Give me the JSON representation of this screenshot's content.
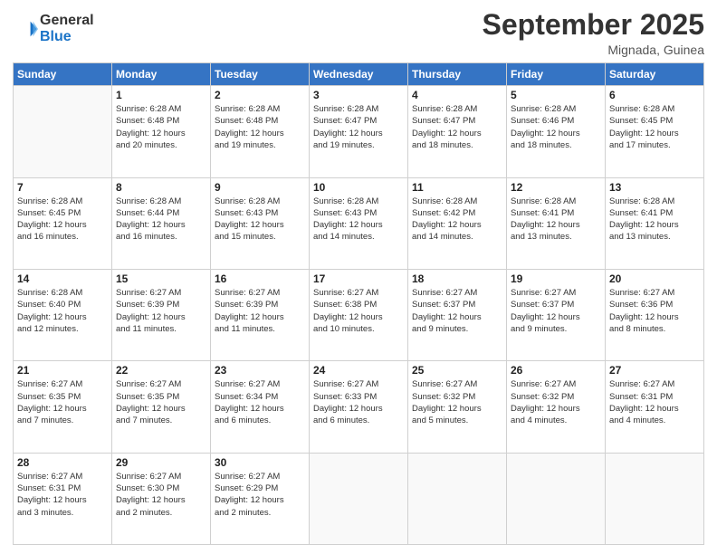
{
  "logo": {
    "general": "General",
    "blue": "Blue"
  },
  "header": {
    "month": "September 2025",
    "location": "Mignada, Guinea"
  },
  "days_of_week": [
    "Sunday",
    "Monday",
    "Tuesday",
    "Wednesday",
    "Thursday",
    "Friday",
    "Saturday"
  ],
  "weeks": [
    [
      {
        "day": "",
        "info": ""
      },
      {
        "day": "1",
        "info": "Sunrise: 6:28 AM\nSunset: 6:48 PM\nDaylight: 12 hours\nand 20 minutes."
      },
      {
        "day": "2",
        "info": "Sunrise: 6:28 AM\nSunset: 6:48 PM\nDaylight: 12 hours\nand 19 minutes."
      },
      {
        "day": "3",
        "info": "Sunrise: 6:28 AM\nSunset: 6:47 PM\nDaylight: 12 hours\nand 19 minutes."
      },
      {
        "day": "4",
        "info": "Sunrise: 6:28 AM\nSunset: 6:47 PM\nDaylight: 12 hours\nand 18 minutes."
      },
      {
        "day": "5",
        "info": "Sunrise: 6:28 AM\nSunset: 6:46 PM\nDaylight: 12 hours\nand 18 minutes."
      },
      {
        "day": "6",
        "info": "Sunrise: 6:28 AM\nSunset: 6:45 PM\nDaylight: 12 hours\nand 17 minutes."
      }
    ],
    [
      {
        "day": "7",
        "info": "Sunrise: 6:28 AM\nSunset: 6:45 PM\nDaylight: 12 hours\nand 16 minutes."
      },
      {
        "day": "8",
        "info": "Sunrise: 6:28 AM\nSunset: 6:44 PM\nDaylight: 12 hours\nand 16 minutes."
      },
      {
        "day": "9",
        "info": "Sunrise: 6:28 AM\nSunset: 6:43 PM\nDaylight: 12 hours\nand 15 minutes."
      },
      {
        "day": "10",
        "info": "Sunrise: 6:28 AM\nSunset: 6:43 PM\nDaylight: 12 hours\nand 14 minutes."
      },
      {
        "day": "11",
        "info": "Sunrise: 6:28 AM\nSunset: 6:42 PM\nDaylight: 12 hours\nand 14 minutes."
      },
      {
        "day": "12",
        "info": "Sunrise: 6:28 AM\nSunset: 6:41 PM\nDaylight: 12 hours\nand 13 minutes."
      },
      {
        "day": "13",
        "info": "Sunrise: 6:28 AM\nSunset: 6:41 PM\nDaylight: 12 hours\nand 13 minutes."
      }
    ],
    [
      {
        "day": "14",
        "info": "Sunrise: 6:28 AM\nSunset: 6:40 PM\nDaylight: 12 hours\nand 12 minutes."
      },
      {
        "day": "15",
        "info": "Sunrise: 6:27 AM\nSunset: 6:39 PM\nDaylight: 12 hours\nand 11 minutes."
      },
      {
        "day": "16",
        "info": "Sunrise: 6:27 AM\nSunset: 6:39 PM\nDaylight: 12 hours\nand 11 minutes."
      },
      {
        "day": "17",
        "info": "Sunrise: 6:27 AM\nSunset: 6:38 PM\nDaylight: 12 hours\nand 10 minutes."
      },
      {
        "day": "18",
        "info": "Sunrise: 6:27 AM\nSunset: 6:37 PM\nDaylight: 12 hours\nand 9 minutes."
      },
      {
        "day": "19",
        "info": "Sunrise: 6:27 AM\nSunset: 6:37 PM\nDaylight: 12 hours\nand 9 minutes."
      },
      {
        "day": "20",
        "info": "Sunrise: 6:27 AM\nSunset: 6:36 PM\nDaylight: 12 hours\nand 8 minutes."
      }
    ],
    [
      {
        "day": "21",
        "info": "Sunrise: 6:27 AM\nSunset: 6:35 PM\nDaylight: 12 hours\nand 7 minutes."
      },
      {
        "day": "22",
        "info": "Sunrise: 6:27 AM\nSunset: 6:35 PM\nDaylight: 12 hours\nand 7 minutes."
      },
      {
        "day": "23",
        "info": "Sunrise: 6:27 AM\nSunset: 6:34 PM\nDaylight: 12 hours\nand 6 minutes."
      },
      {
        "day": "24",
        "info": "Sunrise: 6:27 AM\nSunset: 6:33 PM\nDaylight: 12 hours\nand 6 minutes."
      },
      {
        "day": "25",
        "info": "Sunrise: 6:27 AM\nSunset: 6:32 PM\nDaylight: 12 hours\nand 5 minutes."
      },
      {
        "day": "26",
        "info": "Sunrise: 6:27 AM\nSunset: 6:32 PM\nDaylight: 12 hours\nand 4 minutes."
      },
      {
        "day": "27",
        "info": "Sunrise: 6:27 AM\nSunset: 6:31 PM\nDaylight: 12 hours\nand 4 minutes."
      }
    ],
    [
      {
        "day": "28",
        "info": "Sunrise: 6:27 AM\nSunset: 6:31 PM\nDaylight: 12 hours\nand 3 minutes."
      },
      {
        "day": "29",
        "info": "Sunrise: 6:27 AM\nSunset: 6:30 PM\nDaylight: 12 hours\nand 2 minutes."
      },
      {
        "day": "30",
        "info": "Sunrise: 6:27 AM\nSunset: 6:29 PM\nDaylight: 12 hours\nand 2 minutes."
      },
      {
        "day": "",
        "info": ""
      },
      {
        "day": "",
        "info": ""
      },
      {
        "day": "",
        "info": ""
      },
      {
        "day": "",
        "info": ""
      }
    ]
  ]
}
